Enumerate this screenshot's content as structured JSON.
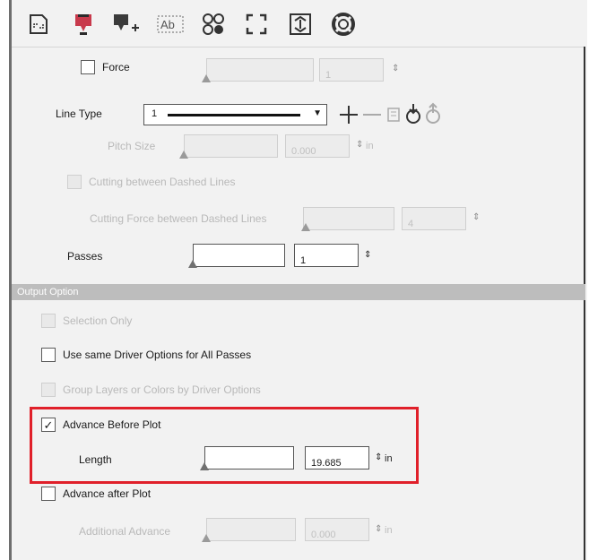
{
  "toolbar": {
    "icons": [
      "page-layout-icon",
      "pen-icon",
      "pen-add-icon",
      "text-outline-icon",
      "circles-icon",
      "frame-corners-icon",
      "register-marks-icon",
      "lifebuoy-icon"
    ]
  },
  "cutting": {
    "force": {
      "label": "Force",
      "value": "1"
    },
    "line_type": {
      "label": "Line Type",
      "value": "1"
    },
    "pitch_size": {
      "label": "Pitch Size",
      "value": "0.000",
      "unit": "in"
    },
    "cutting_between_dashed": {
      "label": "Cutting between Dashed Lines"
    },
    "cutting_force_dashed": {
      "label": "Cutting Force between Dashed Lines",
      "value": "4"
    },
    "passes": {
      "label": "Passes",
      "value": "1"
    }
  },
  "output": {
    "section_title": "Output Option",
    "selection_only": "Selection Only",
    "use_same_driver": "Use same Driver Options for All Passes",
    "group_layers": "Group Layers or Colors by Driver Options",
    "advance_before": {
      "label": "Advance Before Plot",
      "checked_mark": "✓"
    },
    "length": {
      "label": "Length",
      "value": "19.685",
      "unit": "in"
    },
    "advance_after": "Advance after Plot",
    "additional_advance": {
      "label": "Additional Advance",
      "value": "0.000",
      "unit": "in"
    }
  },
  "colors": {
    "highlight": "#e0202a",
    "section_bg": "#bdbdbd",
    "panel_bg": "#f2f2f2"
  }
}
